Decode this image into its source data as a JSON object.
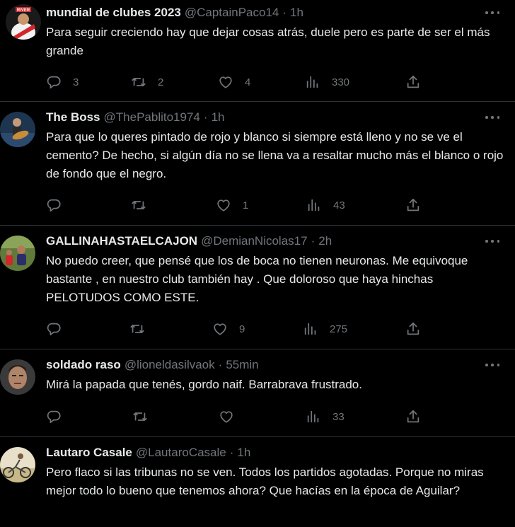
{
  "tweets": [
    {
      "name": "mundial de clubes 2023",
      "handle": "@CaptainPaco14",
      "time": "1h",
      "text": "Para seguir creciendo hay que dejar cosas atrás, duele pero es parte de ser el más grande",
      "replies": "3",
      "retweets": "2",
      "likes": "4",
      "views": "330",
      "avatar_text": "RIVER"
    },
    {
      "name": "The Boss",
      "handle": "@ThePablito1974",
      "time": "1h",
      "text": "Para que lo queres pintado de rojo y blanco si siempre está lleno y no se ve el cemento? De hecho, si algún día no se llena va a resaltar mucho más el blanco o rojo de fondo que el negro.",
      "replies": "",
      "retweets": "",
      "likes": "1",
      "views": "43"
    },
    {
      "name": "GALLINAHASTAELCAJON",
      "handle": "@DemianNicolas17",
      "time": "2h",
      "text": "No puedo creer,  que pensé que los de boca no tienen neuronas. Me equivoque bastante , en nuestro club también hay . Que doloroso que haya hinchas PELOTUDOS COMO ESTE.",
      "replies": "",
      "retweets": "",
      "likes": "9",
      "views": "275"
    },
    {
      "name": "soldado raso",
      "handle": "@lioneldasilvaok",
      "time": "55min",
      "text": "Mirá la papada que tenés, gordo naif. Barrabrava frustrado.",
      "replies": "",
      "retweets": "",
      "likes": "",
      "views": "33"
    },
    {
      "name": "Lautaro Casale",
      "handle": "@LautaroCasale",
      "time": "1h",
      "text": "Pero flaco si las tribunas no se ven. Todos los partidos agotadas. Porque no miras mejor todo lo bueno que tenemos ahora? Que hacías en la época de Aguilar?",
      "replies": "",
      "retweets": "",
      "likes": "",
      "views": ""
    }
  ],
  "separator": "·",
  "colors": {
    "background": "#000000",
    "text": "#e7e9ea",
    "muted": "#71767b",
    "border": "#2f3336"
  },
  "icons": [
    "more-icon",
    "reply-icon",
    "retweet-icon",
    "like-icon",
    "views-icon",
    "share-icon"
  ]
}
